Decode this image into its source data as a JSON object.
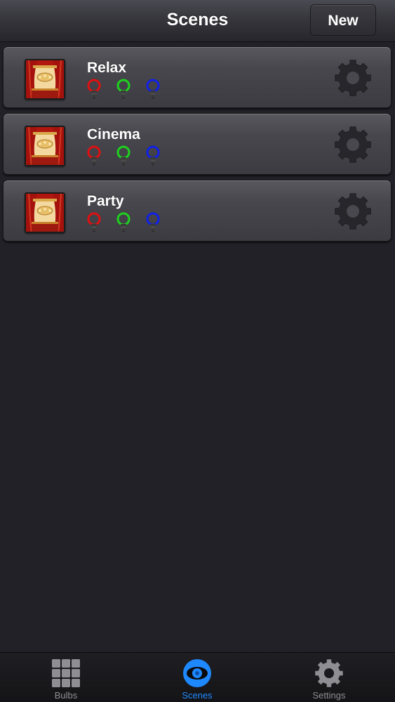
{
  "header": {
    "title": "Scenes",
    "new_label": "New"
  },
  "scenes": [
    {
      "name": "Relax",
      "bulbs": [
        "red",
        "green",
        "blue"
      ]
    },
    {
      "name": "Cinema",
      "bulbs": [
        "red",
        "green",
        "blue"
      ]
    },
    {
      "name": "Party",
      "bulbs": [
        "red",
        "green",
        "blue"
      ]
    }
  ],
  "bulb_colors": {
    "red": "#e01010",
    "green": "#1ed21e",
    "blue": "#1020e8"
  },
  "icons": {
    "scene_thumbnail": "theater-stage-icon",
    "scene_settings": "gear-icon",
    "bulb": "lightbulb-icon"
  },
  "tabs": [
    {
      "label": "Bulbs",
      "icon": "grid-icon",
      "active": false
    },
    {
      "label": "Scenes",
      "icon": "eye-icon",
      "active": true
    },
    {
      "label": "Settings",
      "icon": "gear-icon",
      "active": false
    }
  ],
  "colors": {
    "accent": "#1e88ff",
    "background": "#212127",
    "inactive_tab": "#8e8e93"
  }
}
